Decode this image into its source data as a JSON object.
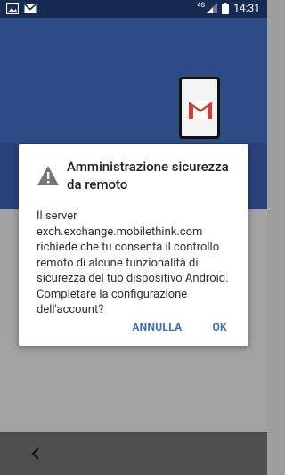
{
  "status_bar": {
    "network_label": "4G",
    "time": "14:31",
    "left_icons": [
      "image-icon",
      "gmail-icon"
    ]
  },
  "dialog": {
    "title": "Amministrazione sicurezza da remoto",
    "message": "Il server exch.exchange.mobilethink.com richiede che tu consenta il controllo remoto di alcune funzionalità di sicurezza del tuo dispositivo Android. Completare la configurazione dell'account?",
    "cancel_label": "ANNULLA",
    "ok_label": "OK"
  },
  "colors": {
    "header": "#2f4b87",
    "accent": "#3b6fc4",
    "gmail_red": "#d23f31"
  }
}
